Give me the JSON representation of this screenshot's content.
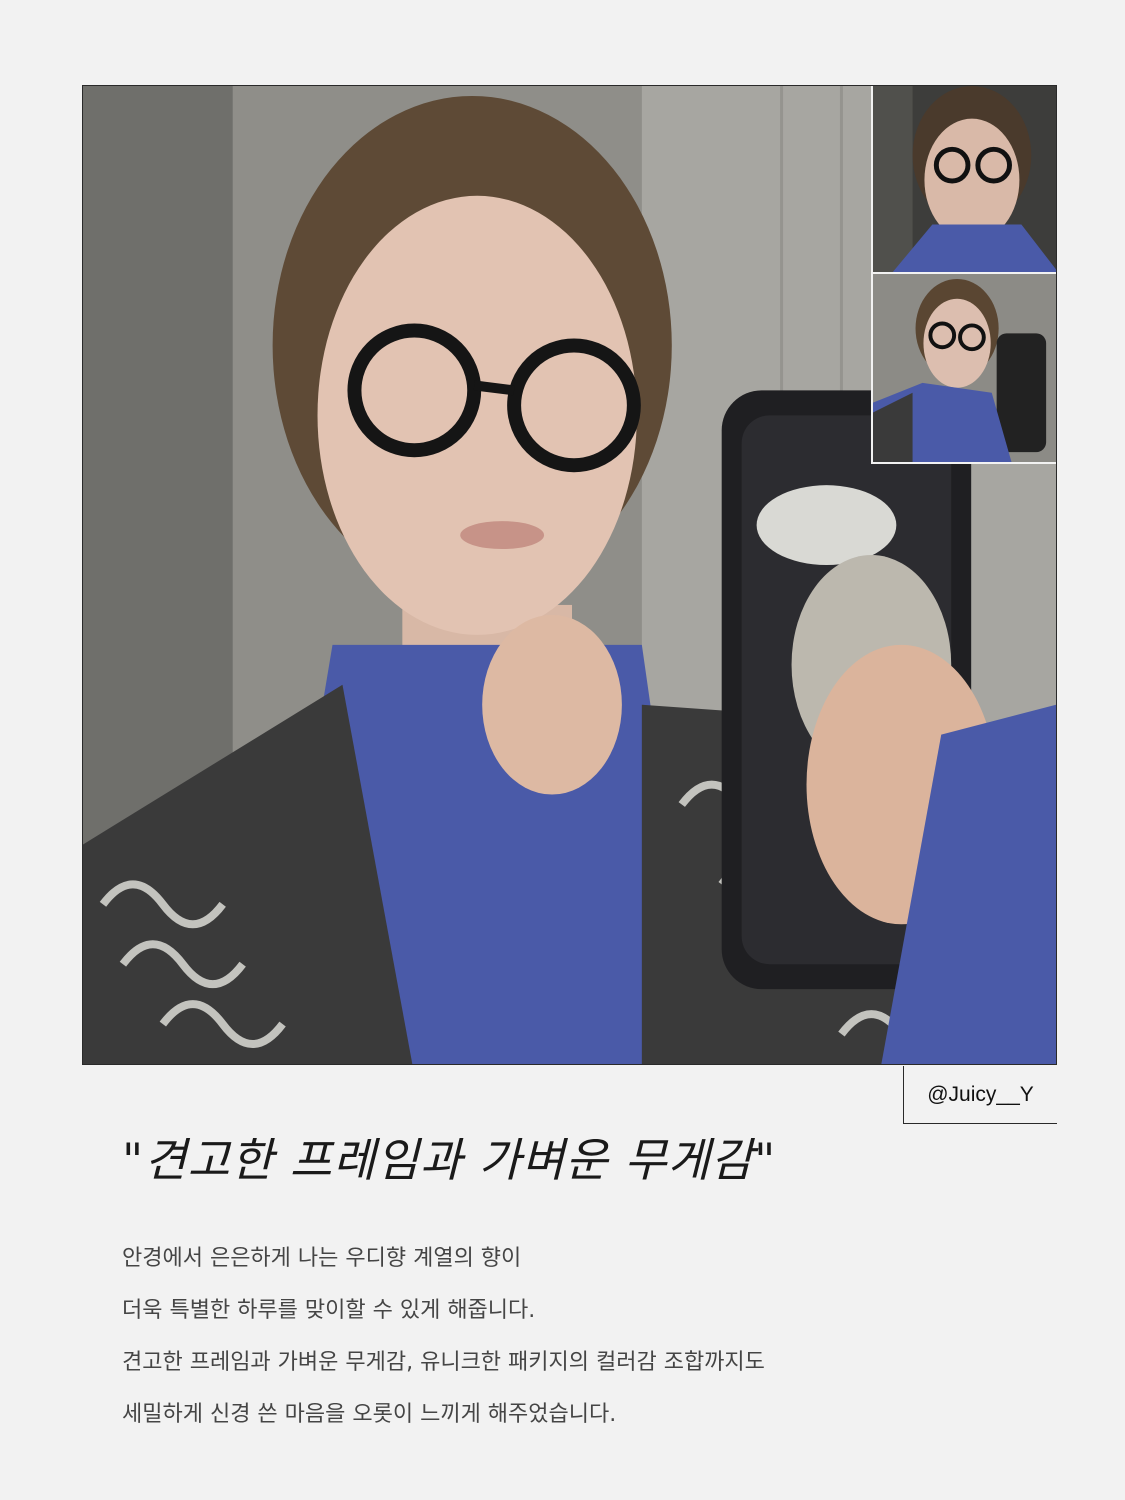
{
  "photo": {
    "main_alt": "mirror selfie",
    "thumb_1_alt": "selfie thumbnail",
    "thumb_2_alt": "mirror selfie thumbnail"
  },
  "handle": "@Juicy__Y",
  "headline": "\"견고한 프레임과 가벼운 무게감\"",
  "body_lines": [
    "안경에서 은은하게 나는 우디향 계열의 향이",
    "더욱 특별한 하루를 맞이할 수 있게 해줍니다.",
    "견고한 프레임과 가벼운 무게감, 유니크한 패키지의 컬러감 조합까지도",
    "세밀하게 신경 쓴 마음을 오롯이 느끼게 해주었습니다."
  ],
  "colors": {
    "background": "#f2f2f2",
    "frame_border": "#2a2a2a",
    "sweater_blue": "#4a5aa8",
    "text_dark": "#1a1a1a",
    "text_body": "#454545"
  }
}
